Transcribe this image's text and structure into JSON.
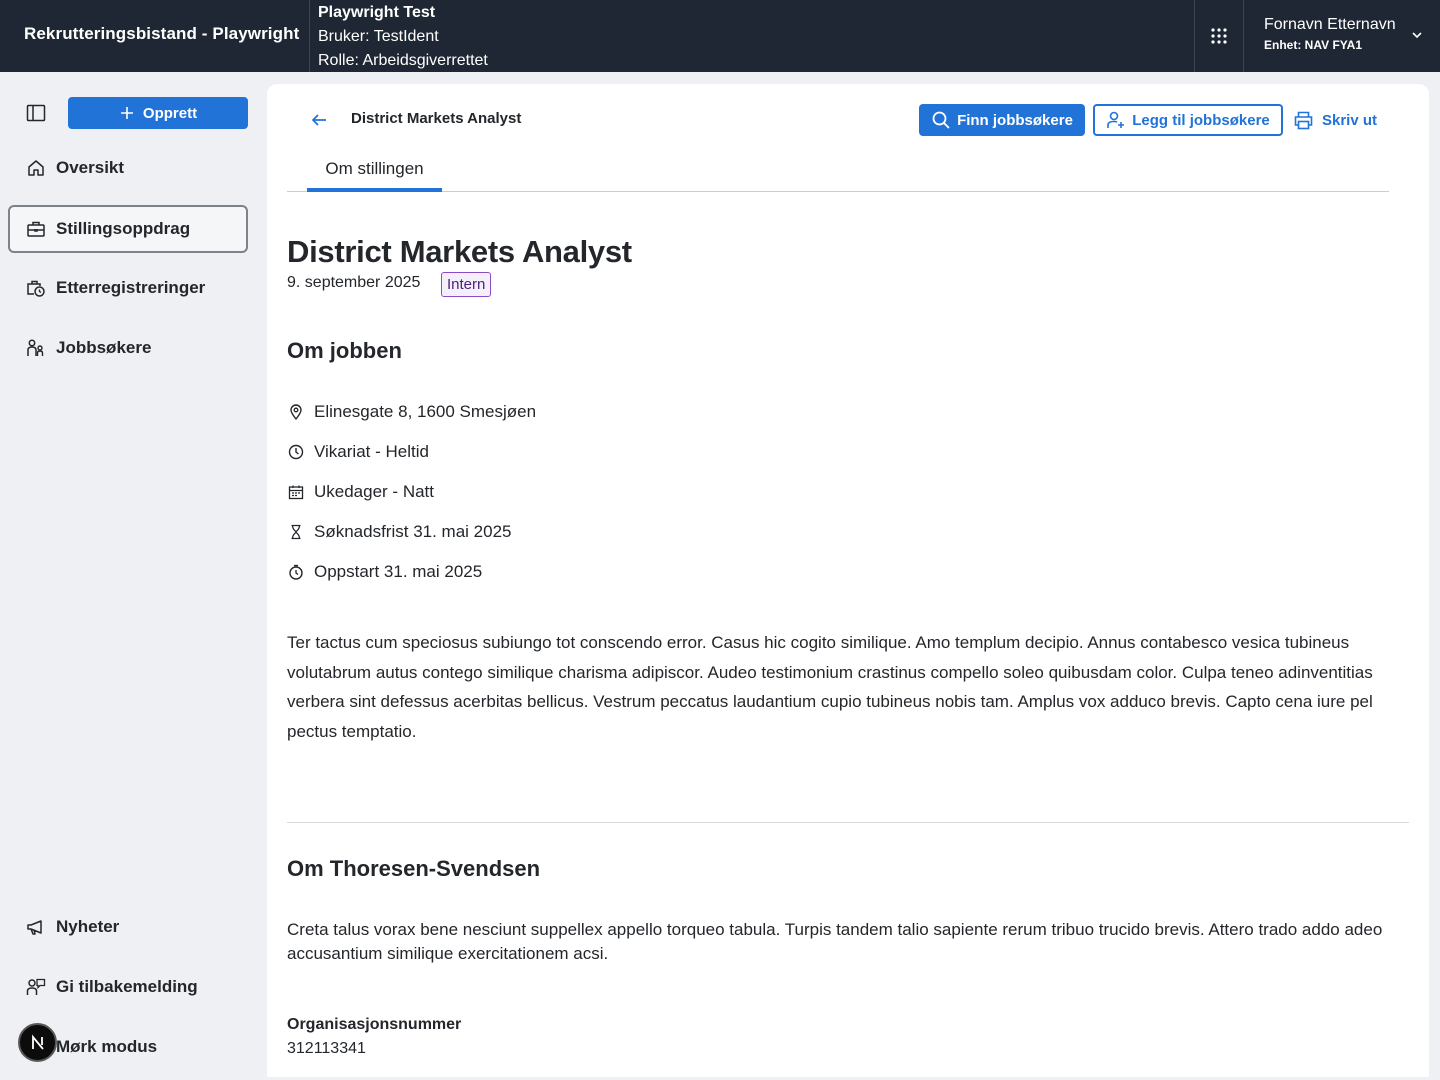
{
  "header": {
    "app_title": "Rekrutteringsbistand - Playwright",
    "test_title": "Playwright Test",
    "user_line": "Bruker: TestIdent",
    "role_line": "Rolle: Arbeidsgiverrettet",
    "user_name": "Fornavn Etternavn",
    "user_unit": "Enhet: NAV FYA1"
  },
  "sidebar": {
    "create_label": "Opprett",
    "items": [
      {
        "label": "Oversikt",
        "icon": "house-icon"
      },
      {
        "label": "Stillingsoppdrag",
        "icon": "briefcase-icon",
        "active": true
      },
      {
        "label": "Etterregistreringer",
        "icon": "briefcase-clock-icon"
      },
      {
        "label": "Jobbsøkere",
        "icon": "people-icon"
      }
    ],
    "bottom_items": [
      {
        "label": "Nyheter",
        "icon": "megaphone-icon"
      },
      {
        "label": "Gi tilbakemelding",
        "icon": "feedback-icon"
      },
      {
        "label": "Mørk modus",
        "icon": "moon-icon"
      }
    ]
  },
  "page": {
    "breadcrumb_title": "District Markets Analyst",
    "find_btn": "Finn jobbsøkere",
    "add_btn": "Legg til jobbsøkere",
    "print_btn": "Skriv ut",
    "tab_label": "Om stillingen",
    "title": "District Markets Analyst",
    "date": "9. september 2025",
    "tag": "Intern",
    "about_job_heading": "Om jobben",
    "info": {
      "address": "Elinesgate 8, 1600 Smesjøen",
      "employment": "Vikariat - Heltid",
      "schedule": "Ukedager - Natt",
      "deadline": "Søknadsfrist 31. mai 2025",
      "start": "Oppstart 31. mai 2025"
    },
    "description": "Ter tactus cum speciosus subiungo tot conscendo error. Casus hic cogito similique. Amo templum decipio. Annus contabesco vesica tubineus volutabrum autus contego similique charisma adipiscor. Audeo testimonium crastinus compello soleo quibusdam color. Culpa teneo adinventitias verbera sint defessus acerbitas bellicus. Vestrum peccatus laudantium cupio tubineus nobis tam. Amplus vox adduco brevis. Capto cena iure pel pectus temptatio.",
    "employer_heading": "Om Thoresen-Svendsen",
    "employer_description": "Creta talus vorax bene nesciunt suppellex appello torqueo tabula. Turpis tandem talio sapiente rerum tribuo trucido brevis. Attero trado addo adeo accusantium similique exercitationem acsi.",
    "org_label": "Organisasjonsnummer",
    "org_value": "312113341"
  },
  "colors": {
    "header_bg": "#1e2733",
    "accent": "#2273d7",
    "tag_border": "#8a4bc9"
  }
}
